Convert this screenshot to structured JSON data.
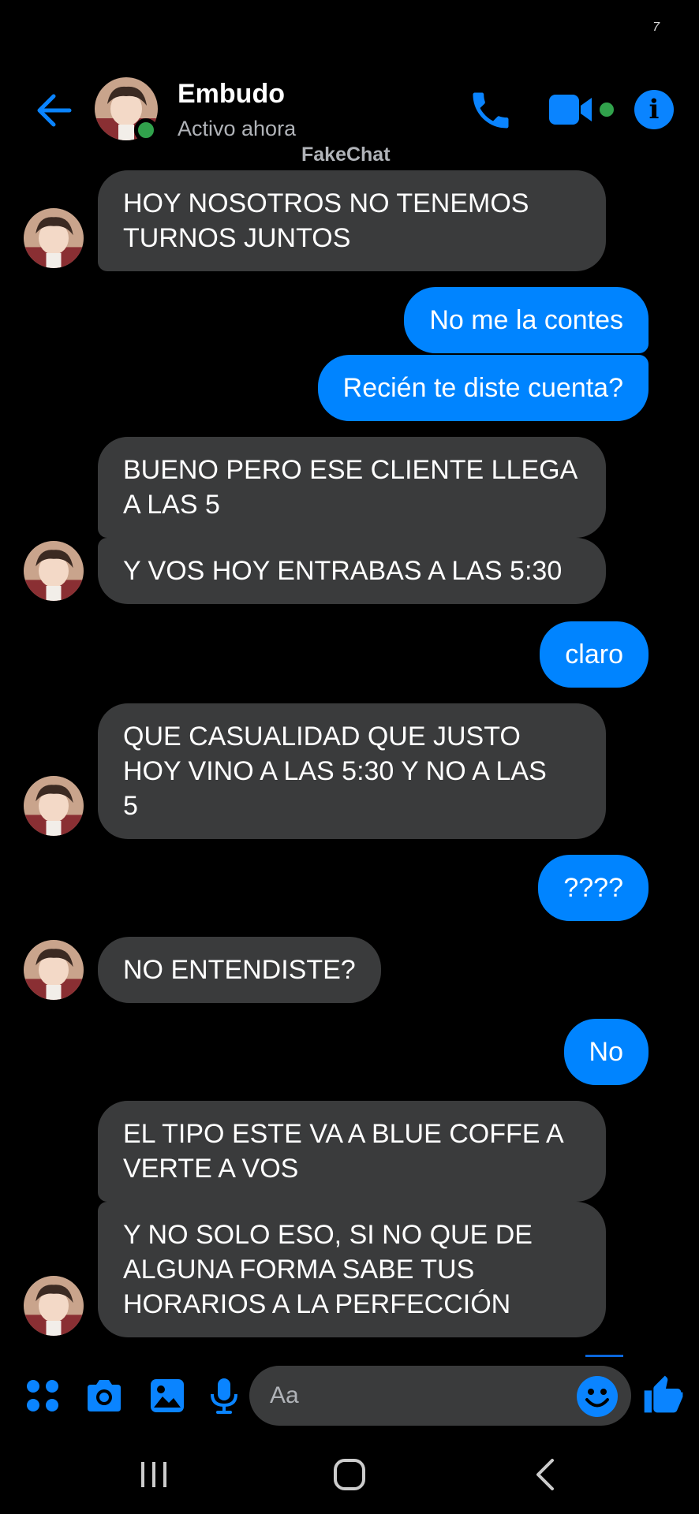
{
  "status": {
    "mark": "7"
  },
  "header": {
    "contact_name": "Embudo",
    "contact_status": "Activo ahora",
    "watermark": "FakeChat",
    "icons": [
      "back-arrow-icon",
      "phone-icon",
      "video-camera-icon",
      "info-icon"
    ]
  },
  "colors": {
    "accent": "#0a84ff",
    "sent_bubble": "#0084ff",
    "received_bubble": "#3a3b3c",
    "online": "#31a24c",
    "background": "#000000"
  },
  "messages": [
    {
      "from": "contact",
      "text": "HOY NOSOTROS NO TENEMOS\nTURNOS JUNTOS"
    },
    {
      "from": "me",
      "text": "No me la contes"
    },
    {
      "from": "me",
      "text": "Recién te diste cuenta?"
    },
    {
      "from": "contact",
      "text": "BUENO PERO ESE CLIENTE LLEGA\nA LAS 5"
    },
    {
      "from": "contact",
      "text": "Y VOS HOY ENTRABAS A LAS 5:30"
    },
    {
      "from": "me",
      "text": "claro"
    },
    {
      "from": "contact",
      "text": "QUE CASUALIDAD QUE JUSTO\nHOY VINO A LAS 5:30 Y NO A LAS\n5"
    },
    {
      "from": "me",
      "text": "????"
    },
    {
      "from": "contact",
      "text": "NO ENTENDISTE?"
    },
    {
      "from": "me",
      "text": "No"
    },
    {
      "from": "contact",
      "text": "EL TIPO ESTE VA A BLUE COFFE A\nVERTE A VOS"
    },
    {
      "from": "contact",
      "text": "Y NO SOLO ESO, SI NO QUE DE\nALGUNA FORMA SABE TUS\nHORARIOS A LA PERFECCIÓN"
    }
  ],
  "composer": {
    "placeholder": "Aa",
    "icons": [
      "apps-grid-icon",
      "camera-icon",
      "gallery-icon",
      "microphone-icon",
      "emoji-icon",
      "thumbs-up-icon"
    ]
  },
  "navbar": {
    "icons": [
      "recent-apps-icon",
      "home-icon",
      "back-icon"
    ]
  }
}
